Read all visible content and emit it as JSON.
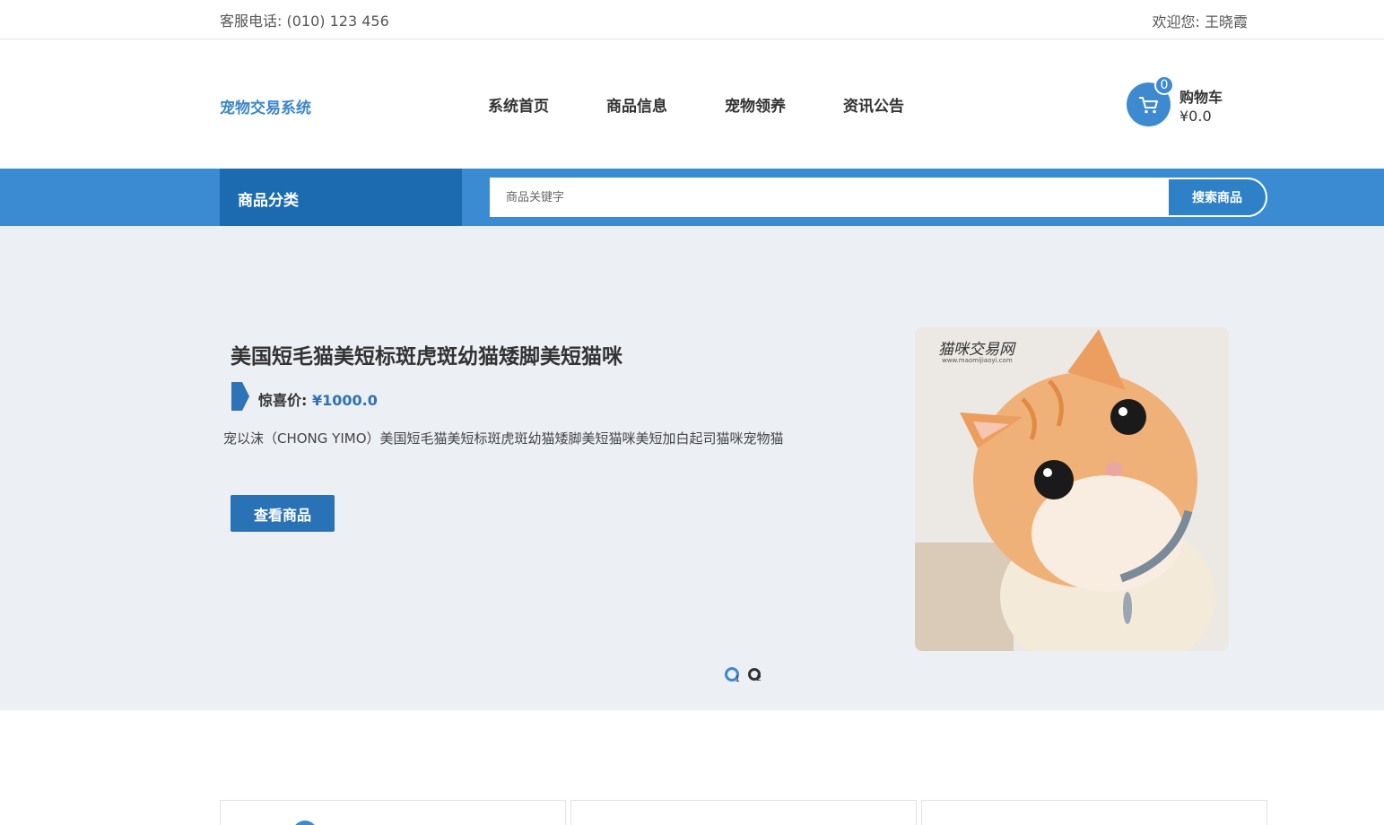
{
  "topbar": {
    "phone": "客服电话: (010) 123 456",
    "welcome": "欢迎您: 王晓霞"
  },
  "header": {
    "logo": "宠物交易系统",
    "nav": [
      "系统首页",
      "商品信息",
      "宠物领养",
      "资讯公告"
    ],
    "cart": {
      "count": "0",
      "title": "购物车",
      "total": "¥0.0"
    }
  },
  "search": {
    "category_label": "商品分类",
    "placeholder": "商品关键字",
    "button_label": "搜索商品"
  },
  "banner": {
    "title": "美国短毛猫美短标斑虎斑幼猫矮脚美短猫咪",
    "price_label": "惊喜价:",
    "price_value": "¥1000.0",
    "description": "宠以沫（CHONG YIMO）美国短毛猫美短标斑虎斑幼猫矮脚美短猫咪美短加白起司猫咪宠物猫",
    "button_label": "查看商品",
    "image_watermark": "猫咪交易网",
    "image_watermark_url": "www.maomijiaoyi.com",
    "slides": [
      "1",
      "2"
    ],
    "active_slide": 1
  },
  "icons": {
    "cart": "shopping-cart-icon",
    "price_flag": "price-tag-icon"
  },
  "colors": {
    "accent": "#3a8bd1",
    "accent_dark": "#1c6bb1",
    "button": "#2a72b6",
    "banner_bg": "#eceff4"
  }
}
